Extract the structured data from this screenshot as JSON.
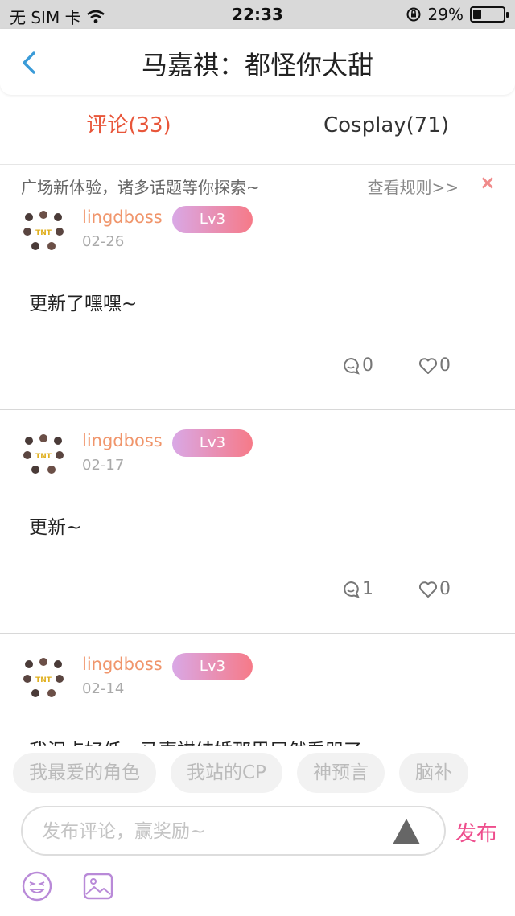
{
  "status_bar": {
    "carrier": "无 SIM 卡",
    "time": "22:33",
    "battery_text": "29%",
    "battery_level": 0.29,
    "icons": [
      "wifi-icon",
      "orientation-lock-icon",
      "battery-icon"
    ]
  },
  "header": {
    "title": "马嘉祺：都怪你太甜",
    "back_icon": "chevron-left-icon"
  },
  "tabs": [
    {
      "label": "评论(33)",
      "active": true
    },
    {
      "label": "Cosplay(71)",
      "active": false
    }
  ],
  "notice": {
    "text": "广场新体验，诸多话题等你探索~",
    "link": "查看规则>>",
    "close": "×"
  },
  "posts": [
    {
      "username": "lingdboss",
      "level": "Lv3",
      "date": "02-26",
      "content": "更新了嘿嘿~",
      "comments": "0",
      "likes": "0"
    },
    {
      "username": "lingdboss",
      "level": "Lv3",
      "date": "02-17",
      "content": "更新~",
      "comments": "1",
      "likes": "0"
    },
    {
      "username": "lingdboss",
      "level": "Lv3",
      "date": "02-14",
      "content": "我泪点好低，马嘉祺结婚那里居然看哭了wc",
      "comments": "",
      "likes": ""
    }
  ],
  "topic_chips": [
    "我最爱的角色",
    "我站的CP",
    "神预言",
    "脑补"
  ],
  "composer": {
    "placeholder": "发布评论，赢奖励~",
    "publish_label": "发布"
  },
  "colors": {
    "accent_red": "#e8563a",
    "username_orange": "#f0956b",
    "publish_pink": "#ee4d8c",
    "back_blue": "#3a9bd8",
    "toolbar_icon_purple": "#b98ad8"
  }
}
